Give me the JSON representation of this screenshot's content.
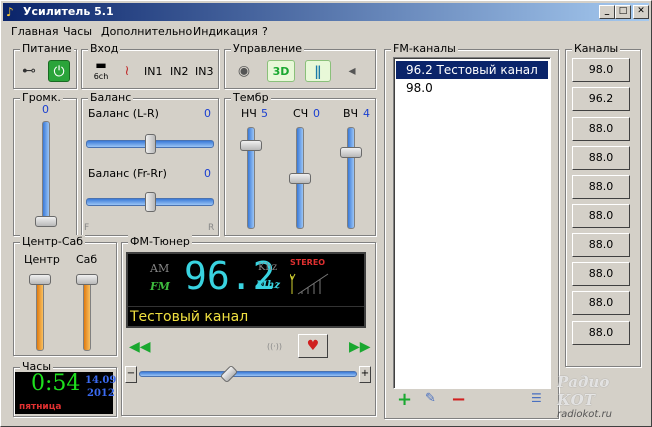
{
  "window": {
    "title": "Усилитель 5.1",
    "app_icon": "note-icon"
  },
  "menu": [
    "Главная",
    "Часы",
    "Дополнительно",
    "Индикация",
    "?"
  ],
  "power": {
    "label": "Питание"
  },
  "input": {
    "label": "Вход",
    "in1": "IN1",
    "in2": "IN2",
    "in3": "IN3",
    "cd_label": "6ch"
  },
  "control": {
    "label": "Управление",
    "btn3d": "3D"
  },
  "volume": {
    "label": "Громк.",
    "value": "0"
  },
  "balance": {
    "label": "Баланс",
    "lr_label": "Баланс (L-R)",
    "lr_value": "0",
    "frr_label": "Баланс (Fr-Rr)",
    "frr_value": "0",
    "f": "F",
    "r": "R"
  },
  "timbre": {
    "label": "Тембр",
    "low_label": "НЧ",
    "low_value": "5",
    "mid_label": "СЧ",
    "mid_value": "0",
    "high_label": "ВЧ",
    "high_value": "4"
  },
  "centersub": {
    "label": "Центр-Саб",
    "center": "Центр",
    "sub": "Саб"
  },
  "tuner": {
    "label": "ФМ-Тюнер",
    "am": "AM",
    "fm": "FM",
    "freq": "96.2",
    "khz": "Khz",
    "mhz": "Mhz",
    "stereo": "STEREO",
    "station": "Тестовый канал"
  },
  "clock": {
    "label": "Часы",
    "time": "0:54",
    "date1": "14.09",
    "date2": "2012",
    "day": "пятница"
  },
  "fm_channels": {
    "label": "FM-каналы",
    "items": [
      "96.2 Тестовый канал",
      "98.0"
    ]
  },
  "channels": {
    "label": "Каналы",
    "buttons": [
      "98.0",
      "96.2",
      "88.0",
      "88.0",
      "88.0",
      "88.0",
      "88.0",
      "88.0",
      "88.0",
      "88.0"
    ]
  },
  "watermark": {
    "line1": "Радио КОТ",
    "line2": "radiokot.ru"
  },
  "colors": {
    "title_start": "#0a246a",
    "title_end": "#a6caf0",
    "accent_blue": "#1a3fd0",
    "tuner_cyan": "#39d3e0",
    "green": "#1aa830"
  }
}
